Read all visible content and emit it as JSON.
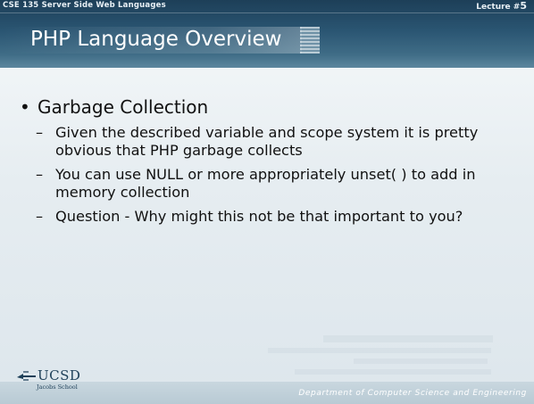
{
  "header": {
    "course": "CSE 135   Server Side Web Languages",
    "lecture_label": "Lecture #",
    "lecture_number": "5",
    "title": "PHP Language Overview"
  },
  "content": {
    "bullet": "Garbage Collection",
    "subitems": [
      "Given the described variable and scope system it is pretty obvious that PHP garbage collects",
      "You can use NULL or more appropriately unset( ) to add in memory collection",
      "Question - Why might this not be that important to you?"
    ]
  },
  "footer": {
    "logo_text": "UCSD",
    "logo_subtext": "Jacobs School",
    "department": "Department of Computer Science and Engineering"
  },
  "colors": {
    "header_dark": "#1d3f58",
    "header_light": "#5d879e",
    "background": "#e6edf1",
    "text": "#111111"
  },
  "icons": {
    "logo_mark": "ucsd-triton-icon"
  }
}
